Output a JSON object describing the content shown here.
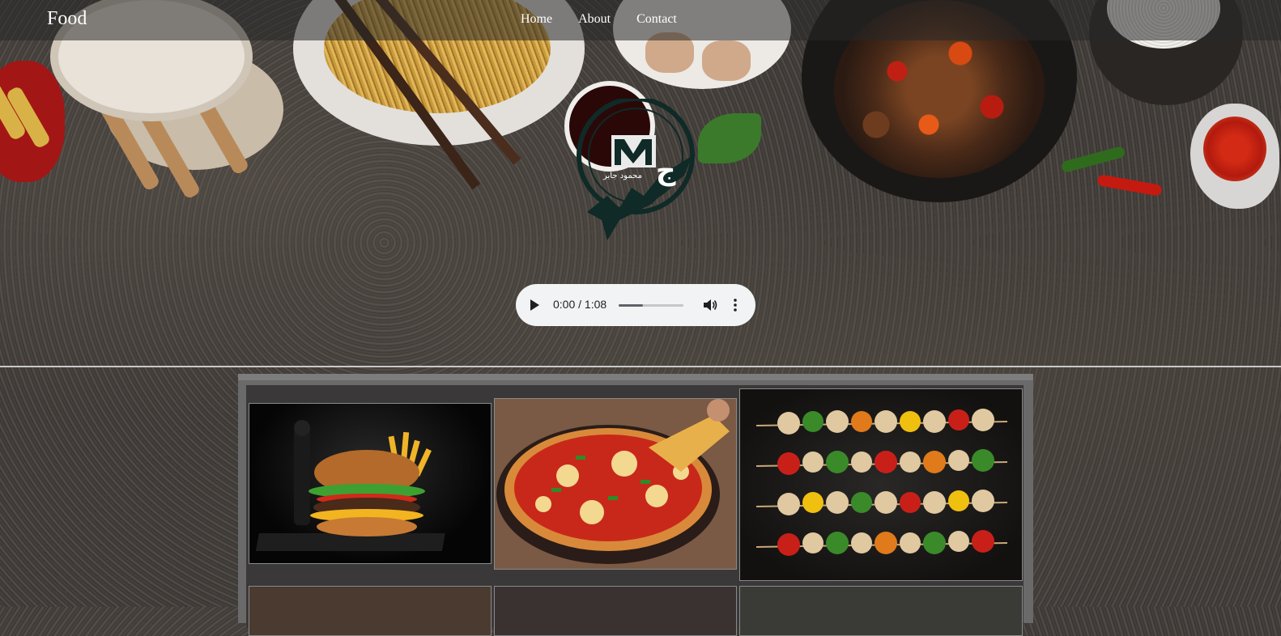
{
  "header": {
    "brand": "Food",
    "nav": [
      "Home",
      "About",
      "Contact"
    ]
  },
  "audio": {
    "time": "0:00 / 1:08",
    "progress_fraction": 0.38
  },
  "gallery": {
    "images": [
      {
        "alt": "burger-image"
      },
      {
        "alt": "pizza-image"
      },
      {
        "alt": "kebab-image"
      }
    ]
  },
  "colors": {
    "header_bg": "#282828",
    "audio_bg": "#f1f3f4",
    "logo": "#0f2a27"
  }
}
